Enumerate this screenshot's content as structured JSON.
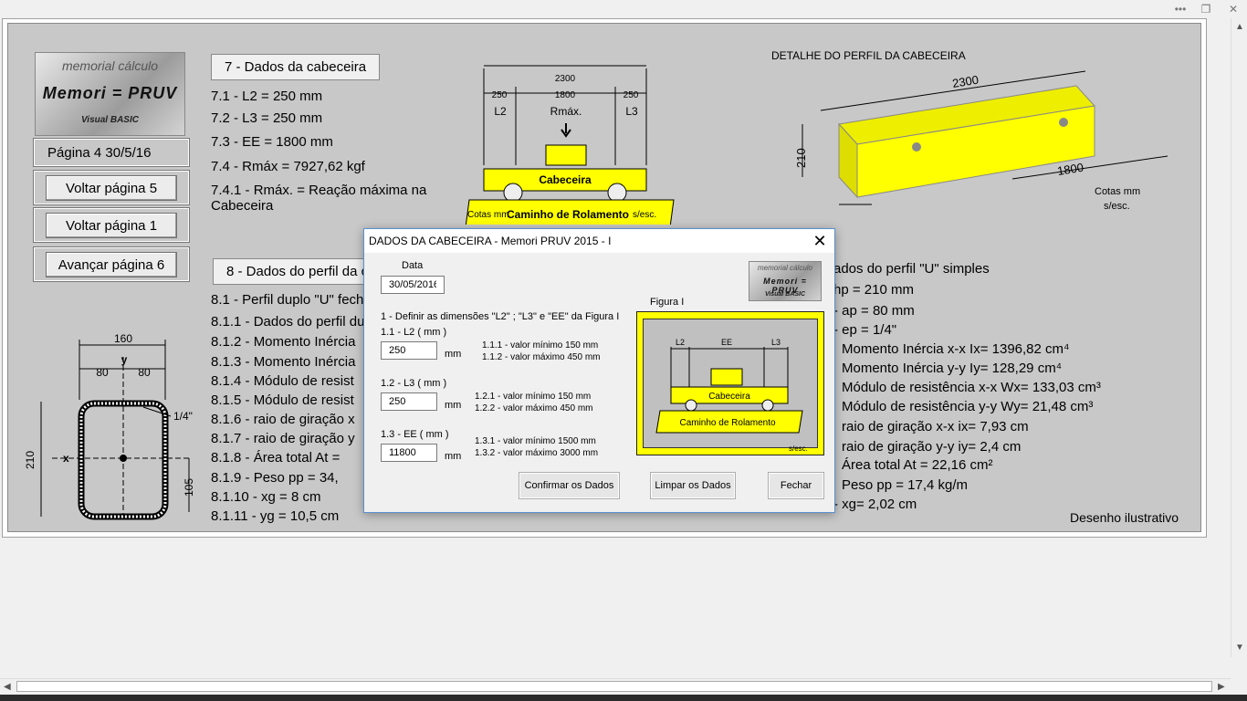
{
  "window": {
    "more_label": "•••",
    "restore_label": "❐",
    "close_label": "✕"
  },
  "logo": {
    "line1": "memorial  cálculo",
    "line2": "Memori = PRUV",
    "line3": "Visual BASIC"
  },
  "left": {
    "page_info": "Página 4     30/5/16",
    "btn_back5": "Voltar página 5",
    "btn_back1": "Voltar  página 1",
    "btn_next6": "Avançar página 6"
  },
  "section7": {
    "title": "7 - Dados da cabeceira",
    "items": [
      "7.1 -   L2 = 250 mm",
      "7.2 -   L3 = 250 mm",
      "7.3 -   EE = 1800 mm",
      "7.4 -  Rmáx = 7927,62 kgf",
      "7.4.1 - Rmáx. = Reação máxima na",
      "Cabeceira"
    ]
  },
  "diagram1": {
    "total": "2300",
    "d_left": "250",
    "d_mid": "1800",
    "d_right": "250",
    "l2": "L2",
    "l3": "L3",
    "rmax": "Rmáx.",
    "cabeceira": "Cabeceira",
    "caminho": "Caminho de Rolamento",
    "cotas": "Cotas mm",
    "sesc": "s/esc."
  },
  "detail": {
    "title": "DETALHE DO PERFIL DA CABECEIRA",
    "len": "2300",
    "h": "210",
    "w": "160",
    "span": "1800",
    "cotas1": "Cotas mm",
    "cotas2": "s/esc."
  },
  "section8": {
    "title": "8 - Dados do perfil da c",
    "items": [
      "8.1 - Perfil duplo \"U\" fecha",
      "8.1.1 - Dados do perfil du",
      "8.1.2 -   Momento Inércia",
      "8.1.3 -   Momento Inércia",
      "8.1.4 -   Módulo de resist",
      "8.1.5 -   Módulo de resist",
      "8.1.6 -   raio de giração x",
      "8.1.7 -   raio de giração y",
      "8.1.8 -   Área total    At =",
      "8.1.9 -   Peso     pp = 34,",
      "8.1.10 -      xg = 8  cm",
      "8.1.11 -      yg = 10,5  cm"
    ]
  },
  "section_u": {
    "items": [
      "ados do perfil \"U\" simples",
      "hp =  210 mm",
      "-  ap =  80 mm",
      "-  ep =  1/4\"",
      "Momento Inércia x-x      Ix= 1396,82  cm⁴",
      "Momento Inércia y-y      Iy= 128,29  cm⁴",
      "Módulo de resistência x-x      Wx= 133,03 cm³",
      "Módulo de resistência y-y      Wy= 21,48 cm³",
      "raio de giração x-x         ix= 7,93  cm",
      "raio de giração y-y         iy= 2,4  cm",
      "Área total       At = 22,16  cm²",
      "Peso      pp = 17,4  kg/m",
      "-      xg= 2,02  cm"
    ],
    "note": "Desenho ilustrativo"
  },
  "section_drawing": {
    "w": "160",
    "y": "y",
    "half_l": "80",
    "half_r": "80",
    "x": "x",
    "h": "210",
    "hh": "105",
    "t": "1/4\""
  },
  "dialog": {
    "title": "DADOS DA CABECEIRA - Memori PRUV 2015 - I",
    "close": "✕",
    "data_label": "Data",
    "data_value": "30/05/2016",
    "instruction": "1 - Definir as dimensões \"L2\" ; \"L3\"  e \"EE\" da Figura I",
    "l2_label": "1.1 - L2  ( mm )",
    "l2_value": "250",
    "l2_min": "1.1.1 - valor mínimo  150 mm",
    "l2_max": "1.1.2 - valor máximo 450 mm",
    "l3_label": "1.2 - L3  ( mm )",
    "l3_value": "250",
    "l3_min": "1.2.1 - valor mínimo  150 mm",
    "l3_max": "1.2.2 - valor máximo 450 mm",
    "ee_label": "1.3 - EE  ( mm )",
    "ee_value": "11800",
    "ee_min": "1.3.1 - valor mínimo  1500 mm",
    "ee_max": "1.3.2 - valor máximo 3000 mm",
    "unit": "mm",
    "figure_label": "Figura I",
    "fig": {
      "l2": "L2",
      "ee": "EE",
      "l3": "L3",
      "cabeceira": "Cabeceira",
      "caminho": "Caminho  de Rolamento",
      "sesc": "s/esc."
    },
    "btn_confirm": "Confirmar os Dados",
    "btn_clear": "Limpar os Dados",
    "btn_close": "Fechar"
  },
  "colors": {
    "yellow": "#ffff00",
    "page_bg": "#c8c8c8",
    "dialog_border": "#5a8fd0"
  }
}
